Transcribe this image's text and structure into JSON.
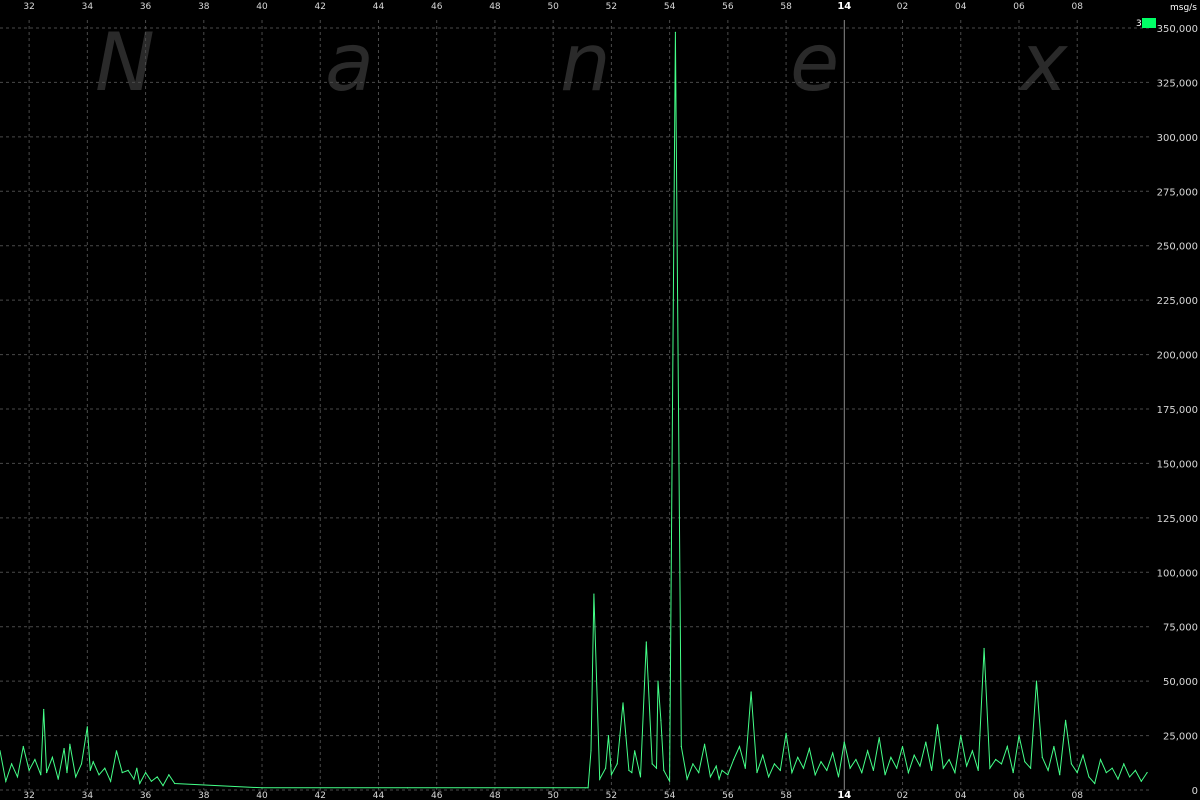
{
  "watermark": [
    "N",
    "a",
    "n",
    "e",
    "x"
  ],
  "chart_data": {
    "type": "line",
    "ylabel": "msg/s",
    "ylim": [
      0,
      350000
    ],
    "yticks": [
      0,
      25000,
      50000,
      75000,
      100000,
      125000,
      150000,
      175000,
      200000,
      225000,
      250000,
      275000,
      300000,
      325000,
      350000
    ],
    "ytick_labels": [
      "0",
      "25,000",
      "50,000",
      "75,000",
      "100,000",
      "125,000",
      "150,000",
      "175,000",
      "200,000",
      "225,000",
      "250,000",
      "275,000",
      "300,000",
      "325,000",
      "350,000"
    ],
    "xlim": [
      31.0,
      70.5
    ],
    "xticks": [
      32,
      34,
      36,
      38,
      40,
      42,
      44,
      46,
      48,
      50,
      52,
      54,
      56,
      58,
      60,
      62,
      64,
      66,
      68
    ],
    "xtick_labels": [
      "32",
      "34",
      "36",
      "38",
      "40",
      "42",
      "44",
      "46",
      "48",
      "50",
      "52",
      "54",
      "56",
      "58",
      "14",
      "02",
      "04",
      "06",
      "08"
    ],
    "hour_marker_x": 60,
    "legend": {
      "label": "3",
      "color": "#00ff66"
    },
    "line_color": "#44ff88",
    "grid": true,
    "series": [
      {
        "name": "3",
        "x": [
          31.0,
          31.2,
          31.4,
          31.6,
          31.8,
          32.0,
          32.2,
          32.4,
          32.5,
          32.6,
          32.8,
          33.0,
          33.2,
          33.3,
          33.4,
          33.6,
          33.8,
          34.0,
          34.1,
          34.2,
          34.4,
          34.6,
          34.8,
          35.0,
          35.2,
          35.4,
          35.6,
          35.7,
          35.8,
          36.0,
          36.2,
          36.4,
          36.6,
          36.8,
          37.0,
          40.0,
          45.0,
          50.0,
          51.1,
          51.2,
          51.3,
          51.4,
          51.6,
          51.8,
          51.9,
          52.0,
          52.2,
          52.4,
          52.6,
          52.7,
          52.8,
          53.0,
          53.2,
          53.4,
          53.55,
          53.6,
          53.7,
          53.8,
          54.0,
          54.2,
          54.4,
          54.6,
          54.8,
          55.0,
          55.2,
          55.4,
          55.6,
          55.7,
          55.8,
          56.0,
          56.2,
          56.4,
          56.6,
          56.8,
          57.0,
          57.2,
          57.4,
          57.6,
          57.8,
          58.0,
          58.2,
          58.4,
          58.6,
          58.8,
          59.0,
          59.2,
          59.4,
          59.6,
          59.8,
          60.0,
          60.2,
          60.4,
          60.6,
          60.8,
          61.0,
          61.2,
          61.4,
          61.6,
          61.8,
          62.0,
          62.2,
          62.4,
          62.6,
          62.8,
          63.0,
          63.2,
          63.4,
          63.6,
          63.8,
          64.0,
          64.2,
          64.4,
          64.6,
          64.8,
          65.0,
          65.2,
          65.4,
          65.6,
          65.8,
          66.0,
          66.2,
          66.4,
          66.6,
          66.8,
          67.0,
          67.2,
          67.4,
          67.6,
          67.8,
          68.0,
          68.2,
          68.4,
          68.6,
          68.8,
          69.0,
          69.2,
          69.4,
          69.6,
          69.8,
          70.0,
          70.2,
          70.4
        ],
        "y": [
          18000,
          4000,
          12000,
          6000,
          20000,
          9000,
          14000,
          7000,
          37000,
          8000,
          15000,
          5000,
          19000,
          8000,
          21000,
          6000,
          12000,
          29000,
          9000,
          13000,
          7000,
          10000,
          4000,
          18000,
          8000,
          9000,
          5000,
          10000,
          3000,
          8000,
          4000,
          6000,
          2000,
          7000,
          3000,
          1000,
          1000,
          1000,
          1000,
          1000,
          18000,
          90000,
          5000,
          10000,
          25000,
          7000,
          12000,
          40000,
          9000,
          8000,
          18000,
          6000,
          68000,
          12000,
          10000,
          50000,
          32000,
          9000,
          4000,
          348000,
          20000,
          5000,
          12000,
          8000,
          21000,
          6000,
          11000,
          5000,
          9000,
          7000,
          14000,
          20000,
          10000,
          45000,
          8000,
          16000,
          6000,
          12000,
          9000,
          26000,
          8000,
          15000,
          10000,
          19000,
          7000,
          13000,
          9000,
          17000,
          6000,
          22000,
          10000,
          14000,
          8000,
          18000,
          9000,
          24000,
          7000,
          15000,
          10000,
          20000,
          8000,
          16000,
          11000,
          22000,
          9000,
          30000,
          10000,
          14000,
          8000,
          25000,
          11000,
          18000,
          9000,
          65000,
          10000,
          14000,
          12000,
          20000,
          8000,
          25000,
          13000,
          10000,
          50000,
          15000,
          9000,
          20000,
          7000,
          32000,
          12000,
          8000,
          16000,
          6000,
          3000,
          14000,
          8000,
          10000,
          5000,
          12000,
          6000,
          9000,
          4000,
          8000
        ],
        "annotated_peaks_note_removed": true
      }
    ]
  }
}
